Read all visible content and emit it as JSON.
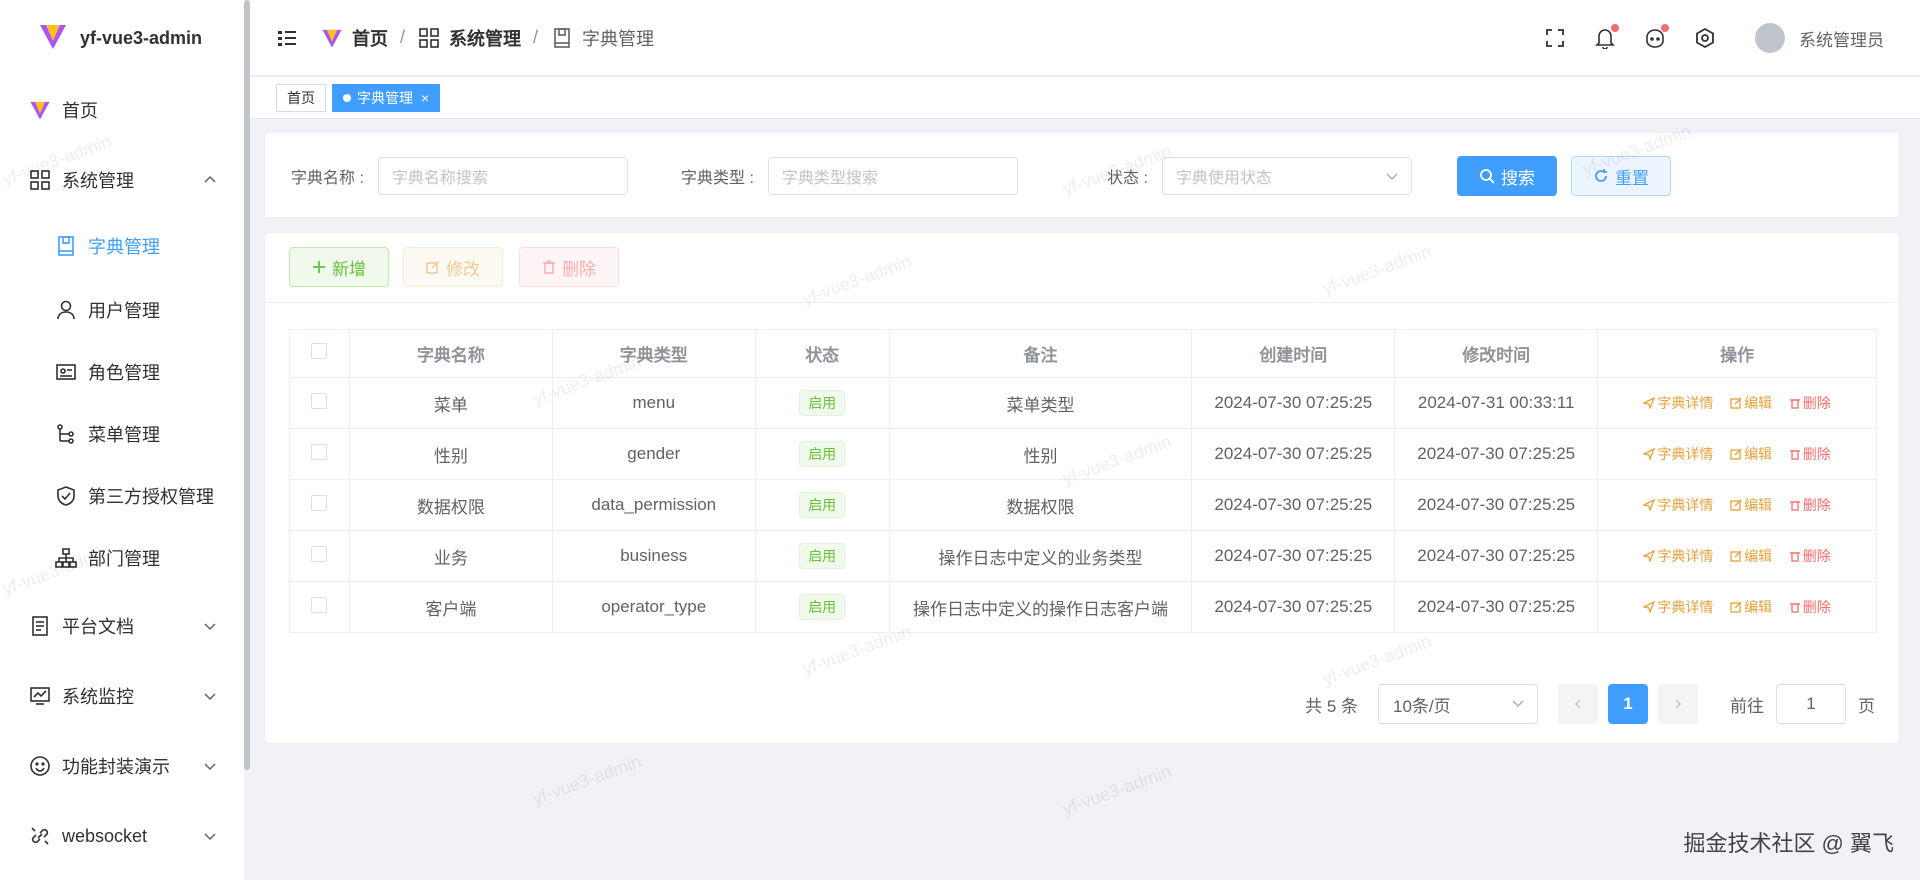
{
  "app": {
    "title": "yf-vue3-admin"
  },
  "sidebar": {
    "items": [
      {
        "label": "首页"
      },
      {
        "label": "系统管理"
      },
      {
        "label": "字典管理"
      },
      {
        "label": "用户管理"
      },
      {
        "label": "角色管理"
      },
      {
        "label": "菜单管理"
      },
      {
        "label": "第三方授权管理"
      },
      {
        "label": "部门管理"
      },
      {
        "label": "平台文档"
      },
      {
        "label": "系统监控"
      },
      {
        "label": "功能封装演示"
      },
      {
        "label": "websocket"
      }
    ]
  },
  "header": {
    "breadcrumb": [
      "首页",
      "系统管理",
      "字典管理"
    ],
    "separator": "/",
    "username": "系统管理员"
  },
  "tabs": [
    {
      "label": "首页"
    },
    {
      "label": "字典管理",
      "close": "×"
    }
  ],
  "search": {
    "name_label": "字典名称 :",
    "name_placeholder": "字典名称搜索",
    "type_label": "字典类型 :",
    "type_placeholder": "字典类型搜索",
    "status_label": "状态 :",
    "status_placeholder": "字典使用状态",
    "search_button": "搜索",
    "reset_button": "重置"
  },
  "toolbar": {
    "add": "新增",
    "edit": "修改",
    "delete": "删除"
  },
  "table": {
    "headers": [
      "字典名称",
      "字典类型",
      "状态",
      "备注",
      "创建时间",
      "修改时间",
      "操作"
    ],
    "rows": [
      {
        "name": "菜单",
        "type": "menu",
        "status": "启用",
        "remark": "菜单类型",
        "created": "2024-07-30 07:25:25",
        "updated": "2024-07-31 00:33:11"
      },
      {
        "name": "性别",
        "type": "gender",
        "status": "启用",
        "remark": "性别",
        "created": "2024-07-30 07:25:25",
        "updated": "2024-07-30 07:25:25"
      },
      {
        "name": "数据权限",
        "type": "data_permission",
        "status": "启用",
        "remark": "数据权限",
        "created": "2024-07-30 07:25:25",
        "updated": "2024-07-30 07:25:25"
      },
      {
        "name": "业务",
        "type": "business",
        "status": "启用",
        "remark": "操作日志中定义的业务类型",
        "created": "2024-07-30 07:25:25",
        "updated": "2024-07-30 07:25:25"
      },
      {
        "name": "客户端",
        "type": "operator_type",
        "status": "启用",
        "remark": "操作日志中定义的操作日志客户端",
        "created": "2024-07-30 07:25:25",
        "updated": "2024-07-30 07:25:25"
      }
    ],
    "ops": {
      "detail": "字典详情",
      "edit": "编辑",
      "delete": "删除"
    }
  },
  "pagination": {
    "total": "共 5 条",
    "page_size": "10条/页",
    "current": "1",
    "goto_label": "前往",
    "goto_value": "1",
    "page_suffix": "页"
  },
  "footer": {
    "mark": "掘金技术社区 @ 翼飞"
  },
  "watermark": {
    "text": "yf-vue3-admin"
  },
  "colors": {
    "primary": "#409eff",
    "success": "#67c23a",
    "warning": "#e6a23c",
    "danger": "#f56c6c"
  }
}
